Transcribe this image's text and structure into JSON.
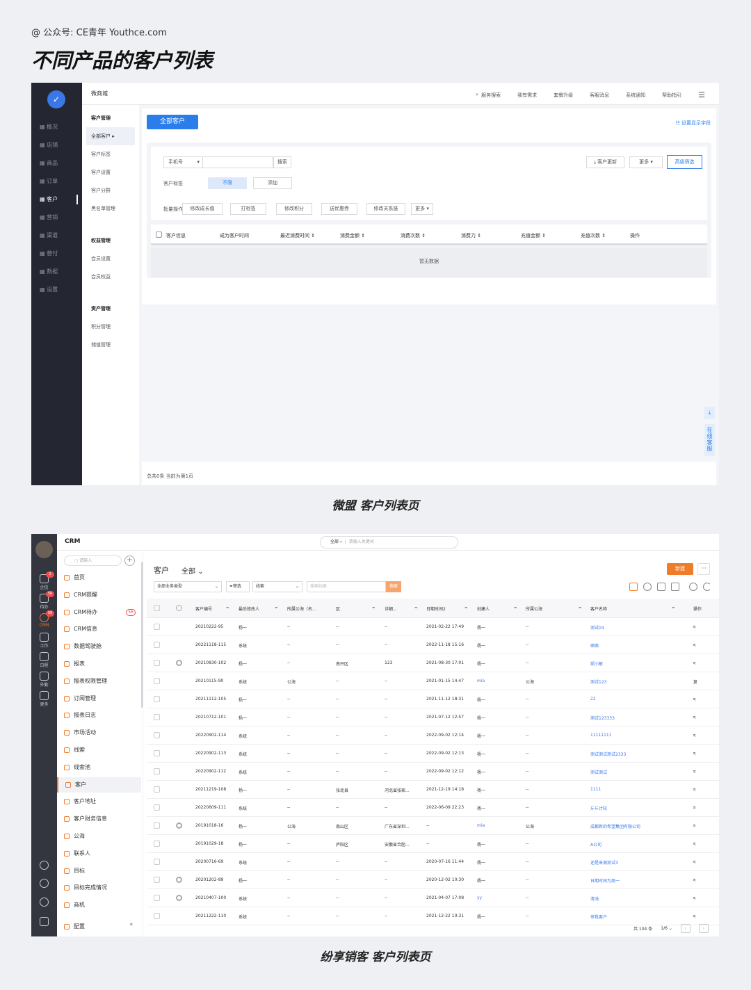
{
  "credit": "@ 公众号: CE青年    Youthce.com",
  "title": "不同产品的客户列表",
  "screen1": {
    "brand": "微商城",
    "top_links": [
      "服务搜索",
      "我有需求",
      "套餐升级",
      "客服消息",
      "系统通知",
      "帮助指引"
    ],
    "nav": [
      "概况",
      "店铺",
      "商品",
      "订单",
      "客户",
      "营销",
      "渠道",
      "替付",
      "数据",
      "设置"
    ],
    "sub_groups": [
      {
        "title": "客户管理",
        "items": [
          "全部客户",
          "客户标签",
          "客户设置",
          "客户分群",
          "黑名单管理"
        ]
      },
      {
        "title": "权益管理",
        "items": [
          "会员设置",
          "会员权益"
        ]
      },
      {
        "title": "资产管理",
        "items": [
          "积分管理",
          "储值管理"
        ]
      }
    ],
    "all_customers_btn": "全部客户",
    "display_fields": "设置显示字段",
    "filter": {
      "phone_select": "手机号",
      "search": "搜索",
      "customer_update": "客户更新",
      "more": "更多",
      "advanced": "高级筛选",
      "tag_label": "客户标签",
      "tag_none": "不限",
      "tag_add": "添加",
      "batch_label": "批量操作",
      "batch": [
        "修改成长值",
        "打标签",
        "修改积分",
        "送优惠券",
        "修改关系链",
        "更多"
      ]
    },
    "columns": [
      "客户信息",
      "成为客户时间",
      "最近消费时间",
      "消费金额",
      "消费次数",
      "消费力",
      "充值金额",
      "充值次数",
      "操作"
    ],
    "empty": "暂无数据",
    "footer": "总共0条 当前为第1页",
    "float_service": "在线客服"
  },
  "caption1": "微盟 客户列表页",
  "screen2": {
    "brand": "CRM",
    "search_scope": "全部",
    "search_placeholder": "请输入关键词",
    "menu_search": "请输入",
    "rail": [
      {
        "label": "企信",
        "badge": "2"
      },
      {
        "label": "待办",
        "badge": "56"
      },
      {
        "label": "CRM",
        "badge": "56"
      },
      {
        "label": "工作",
        "badge": ""
      },
      {
        "label": "日程",
        "badge": ""
      },
      {
        "label": "外勤",
        "badge": ""
      },
      {
        "label": "更多",
        "badge": ""
      }
    ],
    "menu": [
      "首页",
      "CRM提醒",
      "CRM待办",
      "CRM信息",
      "数据驾驶舱",
      "报表",
      "报表权限管理",
      "订阅管理",
      "报表日志",
      "市场活动",
      "线索",
      "线索池",
      "客户",
      "客户地址",
      "客户财务信息",
      "公海",
      "联系人",
      "目标",
      "目标完成情况",
      "商机",
      "配置"
    ],
    "todo_count": "56",
    "heading": "客户",
    "heading_scope": "全部",
    "new_btn": "新建",
    "more_btn": "···",
    "filter_type": "全部业务类型",
    "filter_btn": "筛选",
    "filter_field": "线索",
    "search_placeholder2": "搜索线索",
    "search_btn": "搜索",
    "columns": [
      "客户编号",
      "最后修改人",
      "所属公海（名...",
      "区",
      "详细...",
      "日期时间2",
      "创建人",
      "所属公海",
      "客户名称",
      "操作"
    ],
    "rows": [
      [
        "20210222-95",
        "杨一",
        "--",
        "--",
        "--",
        "2021-02-22 17:49",
        "杨一",
        "--",
        "测试04",
        "",
        "ग"
      ],
      [
        "20221118-115",
        "系统",
        "--",
        "--",
        "--",
        "2022-11-18 15:16",
        "杨一",
        "--",
        "嘶嘶",
        "",
        "ग"
      ],
      [
        "20210830-102",
        "杨一",
        "--",
        "南开区",
        "123",
        "2021-08-30 17:01",
        "杨一",
        "--",
        "郝小敏",
        "loc",
        "ग"
      ],
      [
        "20210115-90",
        "系统",
        "公海",
        "--",
        "--",
        "2021-01-15 14:47",
        "mia",
        "公海",
        "测试123",
        "",
        "复"
      ],
      [
        "20211112-105",
        "杨一",
        "--",
        "--",
        "--",
        "2021-11-12 18:31",
        "杨一",
        "--",
        "22",
        "",
        "ग"
      ],
      [
        "20210712-101",
        "杨一",
        "--",
        "--",
        "--",
        "2021-07-12 12:57",
        "杨一",
        "--",
        "测试123333",
        "",
        "ग"
      ],
      [
        "20220902-114",
        "系统",
        "--",
        "--",
        "--",
        "2022-09-02 12:14",
        "杨一",
        "--",
        "11111111",
        "",
        "ग"
      ],
      [
        "20220902-113",
        "系统",
        "--",
        "--",
        "--",
        "2022-09-02 12:13",
        "杨一",
        "--",
        "测试测试测试2333",
        "",
        "ग"
      ],
      [
        "20220902-112",
        "系统",
        "--",
        "--",
        "--",
        "2022-09-02 12:12",
        "杨一",
        "--",
        "测试测试",
        "",
        "ग"
      ],
      [
        "20211219-108",
        "杨一",
        "--",
        "张北县",
        "河北省张家...",
        "2021-12-19 14:18",
        "杨一",
        "--",
        "1111",
        "",
        "ग"
      ],
      [
        "20220609-111",
        "系统",
        "--",
        "--",
        "--",
        "2022-06-09 22:23",
        "杨一",
        "--",
        "斤斤计较",
        "",
        "ग"
      ],
      [
        "20191018-16",
        "杨一",
        "公海",
        "南山区",
        "广东省深圳...",
        "--",
        "mia",
        "公海",
        "成都新的希望集团有限公司",
        "loc",
        "ग"
      ],
      [
        "20191029-18",
        "杨一",
        "--",
        "庐阳区",
        "安徽省合肥...",
        "--",
        "杨一",
        "--",
        "A公司",
        "",
        "ग"
      ],
      [
        "20200716-69",
        "系统",
        "--",
        "--",
        "--",
        "2020-07-16 11:44",
        "杨一",
        "--",
        "还是来源测试3",
        "",
        "ग"
      ],
      [
        "20201202-89",
        "杨一",
        "--",
        "--",
        "--",
        "2020-12-02 10:30",
        "杨一",
        "--",
        "日期时间为周一",
        "loc",
        "ग"
      ],
      [
        "20210407-100",
        "系统",
        "--",
        "--",
        "--",
        "2021-04-07 17:08",
        "yy",
        "--",
        "清浅",
        "loc",
        "ग"
      ],
      [
        "20211222-110",
        "系统",
        "--",
        "--",
        "--",
        "2021-12-22 10:31",
        "杨一",
        "--",
        "审批客户",
        "",
        "ग"
      ]
    ],
    "pager": {
      "total": "共 104 条",
      "page": "1/6"
    }
  },
  "caption2": "纷享销客 客户列表页"
}
